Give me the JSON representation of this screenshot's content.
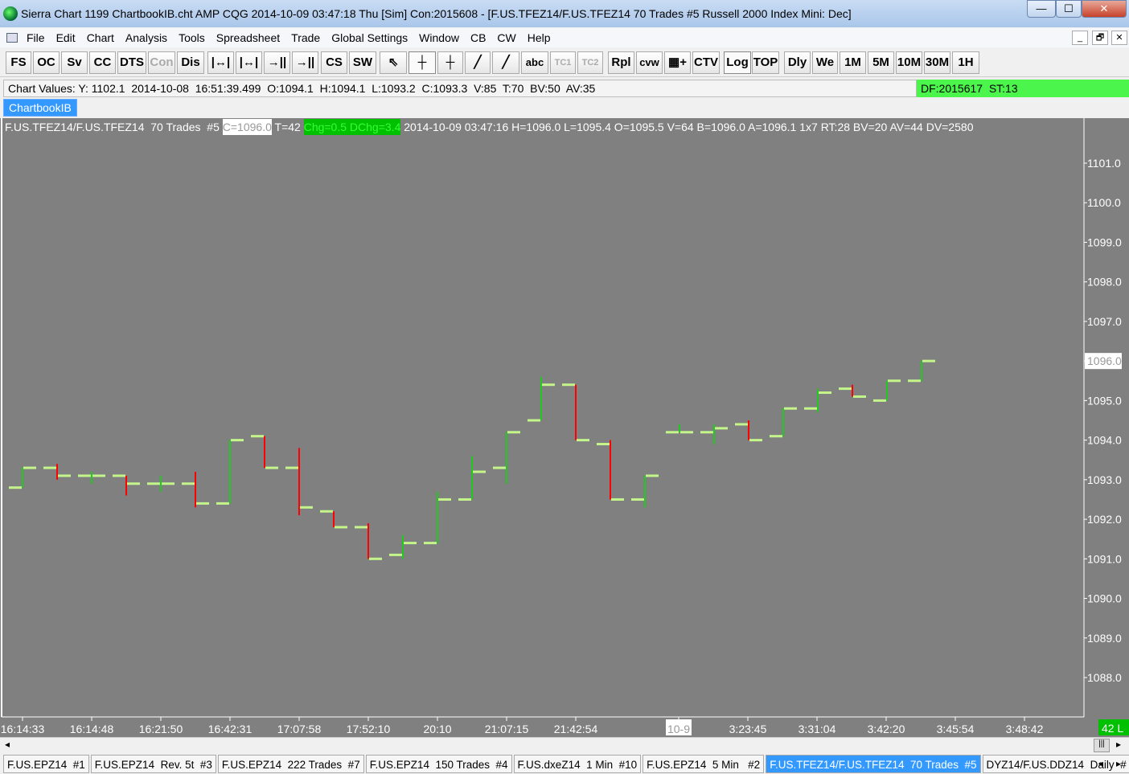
{
  "title": "Sierra Chart 1199 ChartbookIB.cht  AMP CQG 2014-10-09  03:47:18 Thu [Sim]  Con:2015608 - [F.US.TFEZ14/F.US.TFEZ14  70 Trades  #5  Russell 2000 Index Mini: Dec]",
  "window_controls": {
    "minimize": "—",
    "maximize": "☐",
    "close": "✕"
  },
  "menu": [
    "File",
    "Edit",
    "Chart",
    "Analysis",
    "Tools",
    "Spreadsheet",
    "Trade",
    "Global Settings",
    "Window",
    "CB",
    "CW",
    "Help"
  ],
  "mdi_controls": [
    "_",
    "🗗",
    "✕"
  ],
  "toolbar": [
    {
      "label": "FS"
    },
    {
      "label": "OC"
    },
    {
      "label": "Sv"
    },
    {
      "label": "CC"
    },
    {
      "label": "DTS"
    },
    {
      "label": "Con",
      "disabled": true
    },
    {
      "label": "Dis"
    },
    {
      "label": "|↔|"
    },
    {
      "label": "|↔|"
    },
    {
      "label": "→||←"
    },
    {
      "label": "→||←"
    },
    {
      "label": "CS"
    },
    {
      "label": "SW"
    },
    {
      "label": "⇖"
    },
    {
      "label": "┼",
      "active": true
    },
    {
      "label": "┼"
    },
    {
      "label": "╱"
    },
    {
      "label": "╱"
    },
    {
      "label": "abc"
    },
    {
      "label": "TC1",
      "disabled": true
    },
    {
      "label": "TC2",
      "disabled": true
    },
    {
      "label": "Rpl"
    },
    {
      "label": "cvw"
    },
    {
      "label": "▦+"
    },
    {
      "label": "CTV"
    },
    {
      "label": "Log",
      "active": true
    },
    {
      "label": "TOP"
    },
    {
      "label": "Dly"
    },
    {
      "label": "We"
    },
    {
      "label": "1M"
    },
    {
      "label": "5M"
    },
    {
      "label": "10M"
    },
    {
      "label": "30M"
    },
    {
      "label": "1H"
    }
  ],
  "chart_values": "Chart Values: Y: 1102.1  2014-10-08  16:51:39.499  O:1094.1  H:1094.1  L:1093.2  C:1093.3  V:85  T:70  BV:50  AV:35",
  "status": "DF:2015617  ST:13",
  "chartbook_tab": "ChartbookIB",
  "header": {
    "symbol": "F.US.TFEZ14/F.US.TFEZ14  70 Trades  #5 ",
    "close": "C=1096.0",
    "trades": " T=42 ",
    "chg": "Chg=0.5",
    "dchg": " DChg=3.4",
    "rest": " 2014-10-09 03:47:16 H=1096.0 L=1095.4 O=1095.5 V=64 B=1096.0 A=1096.1 1x7 RT:28 BV=20 AV=44 DV=2580"
  },
  "colors": {
    "up": "#00e000",
    "down": "#ff0000",
    "tick": "#c4f58a",
    "bg": "#808080"
  },
  "chart_data": {
    "type": "bar",
    "ylim": [
      1087.3,
      1101.9
    ],
    "y_ticks": [
      "1101.0",
      "1100.0",
      "1099.0",
      "1098.0",
      "1097.0",
      "1096.0",
      "1095.0",
      "1094.0",
      "1093.0",
      "1092.0",
      "1091.0",
      "1090.0",
      "1089.0",
      "1088.0"
    ],
    "current_price": "1096.0",
    "x_ticks": [
      {
        "bar": 0,
        "label": "16:14:33"
      },
      {
        "bar": 2,
        "label": "16:14:48"
      },
      {
        "bar": 4,
        "label": "16:21:50"
      },
      {
        "bar": 6,
        "label": "16:42:31"
      },
      {
        "bar": 8,
        "label": "17:07:58"
      },
      {
        "bar": 10,
        "label": "17:52:10"
      },
      {
        "bar": 12,
        "label": "20:10"
      },
      {
        "bar": 14,
        "label": "21:07:15"
      },
      {
        "bar": 16,
        "label": "21:42:54"
      },
      {
        "bar": 19,
        "label": "10-9",
        "highlight": true
      },
      {
        "bar": 21,
        "label": "3:23:45"
      },
      {
        "bar": 23,
        "label": "3:31:04"
      },
      {
        "bar": 25,
        "label": "3:42:20"
      },
      {
        "bar": 27,
        "label": "3:45:54"
      },
      {
        "bar": 29,
        "label": "3:48:42"
      }
    ],
    "bar_count_label": "42 L",
    "bars": [
      [
        1092.8,
        1093.3,
        1092.8,
        1093.3
      ],
      [
        1093.3,
        1093.4,
        1093.0,
        1093.1
      ],
      [
        1093.1,
        1093.2,
        1092.9,
        1093.1
      ],
      [
        1093.1,
        1093.1,
        1092.6,
        1092.9
      ],
      [
        1092.9,
        1093.1,
        1092.7,
        1092.9
      ],
      [
        1092.9,
        1093.2,
        1092.3,
        1092.4
      ],
      [
        1092.4,
        1094.0,
        1092.4,
        1094.0
      ],
      [
        1094.1,
        1094.1,
        1093.3,
        1093.3
      ],
      [
        1093.3,
        1093.8,
        1092.1,
        1092.3
      ],
      [
        1092.2,
        1092.2,
        1091.8,
        1091.8
      ],
      [
        1091.8,
        1091.9,
        1091.0,
        1091.0
      ],
      [
        1091.1,
        1091.6,
        1091.0,
        1091.4
      ],
      [
        1091.4,
        1092.7,
        1091.4,
        1092.5
      ],
      [
        1092.5,
        1093.6,
        1092.5,
        1093.2
      ],
      [
        1093.3,
        1094.2,
        1092.9,
        1094.2
      ],
      [
        1094.5,
        1095.6,
        1094.5,
        1095.4
      ],
      [
        1095.4,
        1095.4,
        1094.0,
        1094.0
      ],
      [
        1093.9,
        1094.0,
        1092.5,
        1092.5
      ],
      [
        1092.5,
        1093.1,
        1092.3,
        1093.1
      ],
      [
        1094.2,
        1094.4,
        1094.2,
        1094.2
      ],
      [
        1094.2,
        1094.4,
        1093.9,
        1094.3
      ],
      [
        1094.4,
        1094.5,
        1094.0,
        1094.0
      ],
      [
        1094.1,
        1094.8,
        1094.1,
        1094.8
      ],
      [
        1094.8,
        1095.3,
        1094.7,
        1095.2
      ],
      [
        1095.3,
        1095.4,
        1095.1,
        1095.1
      ],
      [
        1095.0,
        1095.5,
        1095.0,
        1095.5
      ],
      [
        1095.5,
        1096.0,
        1095.5,
        1096.0
      ]
    ]
  },
  "sheet_tabs": [
    {
      "label": "F.US.EPZ14  #1"
    },
    {
      "label": "F.US.EPZ14  Rev. 5t  #3"
    },
    {
      "label": "F.US.EPZ14  222 Trades  #7"
    },
    {
      "label": "F.US.EPZ14  150 Trades  #4"
    },
    {
      "label": "F.US.dxeZ14  1 Min  #10"
    },
    {
      "label": "F.US.EPZ14  5 Min   #2"
    },
    {
      "label": "F.US.TFEZ14/F.US.TFEZ14  70 Trades  #5",
      "active": true
    },
    {
      "label": "DYZ14/F.US.DDZ14  Daily  #"
    }
  ],
  "scroll": {
    "left": "◂",
    "right": "▸",
    "thumb": "|||",
    "tab_prev": "◂",
    "tab_next": "▸"
  }
}
